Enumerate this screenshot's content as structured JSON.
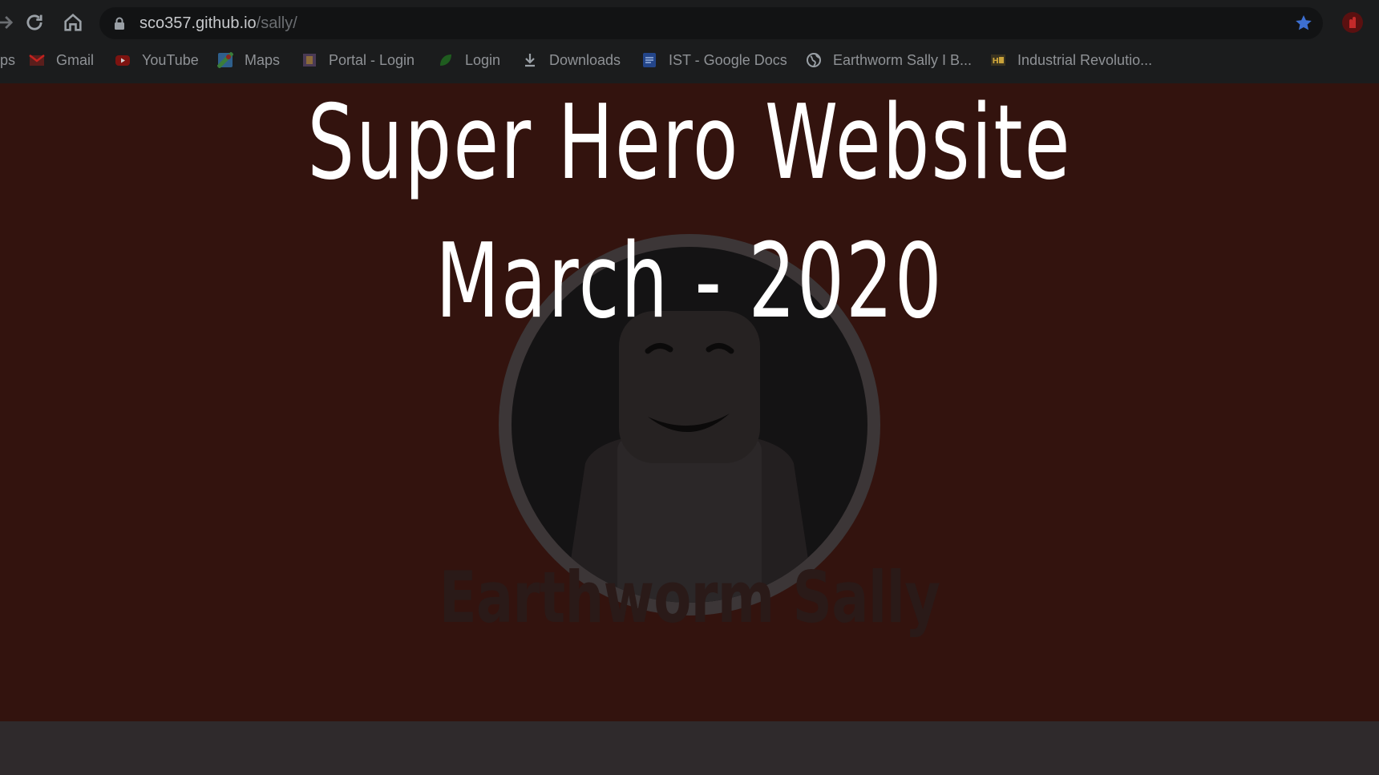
{
  "browser": {
    "url_host": "sco357.github.io",
    "url_path": "/sally/",
    "bookmarks_cut_prefix": "ps",
    "bookmarks": [
      {
        "label": "Gmail",
        "icon": "gmail-icon",
        "color": "#c5221f"
      },
      {
        "label": "YouTube",
        "icon": "youtube-icon",
        "color": "#b3120f"
      },
      {
        "label": "Maps",
        "icon": "maps-icon",
        "color": "#3b7d3a"
      },
      {
        "label": "Portal - Login",
        "icon": "portal-icon",
        "color": "#6b5a7a"
      },
      {
        "label": "Login",
        "icon": "login-icon",
        "color": "#2c7a2c"
      },
      {
        "label": "Downloads",
        "icon": "download-icon",
        "color": "#9aa0a6"
      },
      {
        "label": "IST - Google Docs",
        "icon": "google-docs-icon",
        "color": "#2e5aa8"
      },
      {
        "label": "Earthworm Sally I B...",
        "icon": "globe-icon",
        "color": "#9aa0a6"
      },
      {
        "label": "Industrial Revolutio...",
        "icon": "history-icon",
        "color": "#c9a23a"
      }
    ]
  },
  "overlay": {
    "title_line1": "Super Hero Website",
    "title_line2": "March - 2020"
  },
  "hero": {
    "name": "Earthworm Sally"
  },
  "colors": {
    "hero_bg": "#33130e",
    "chrome_bg": "#1b1c1d",
    "page_bg": "#2f2a2c"
  }
}
